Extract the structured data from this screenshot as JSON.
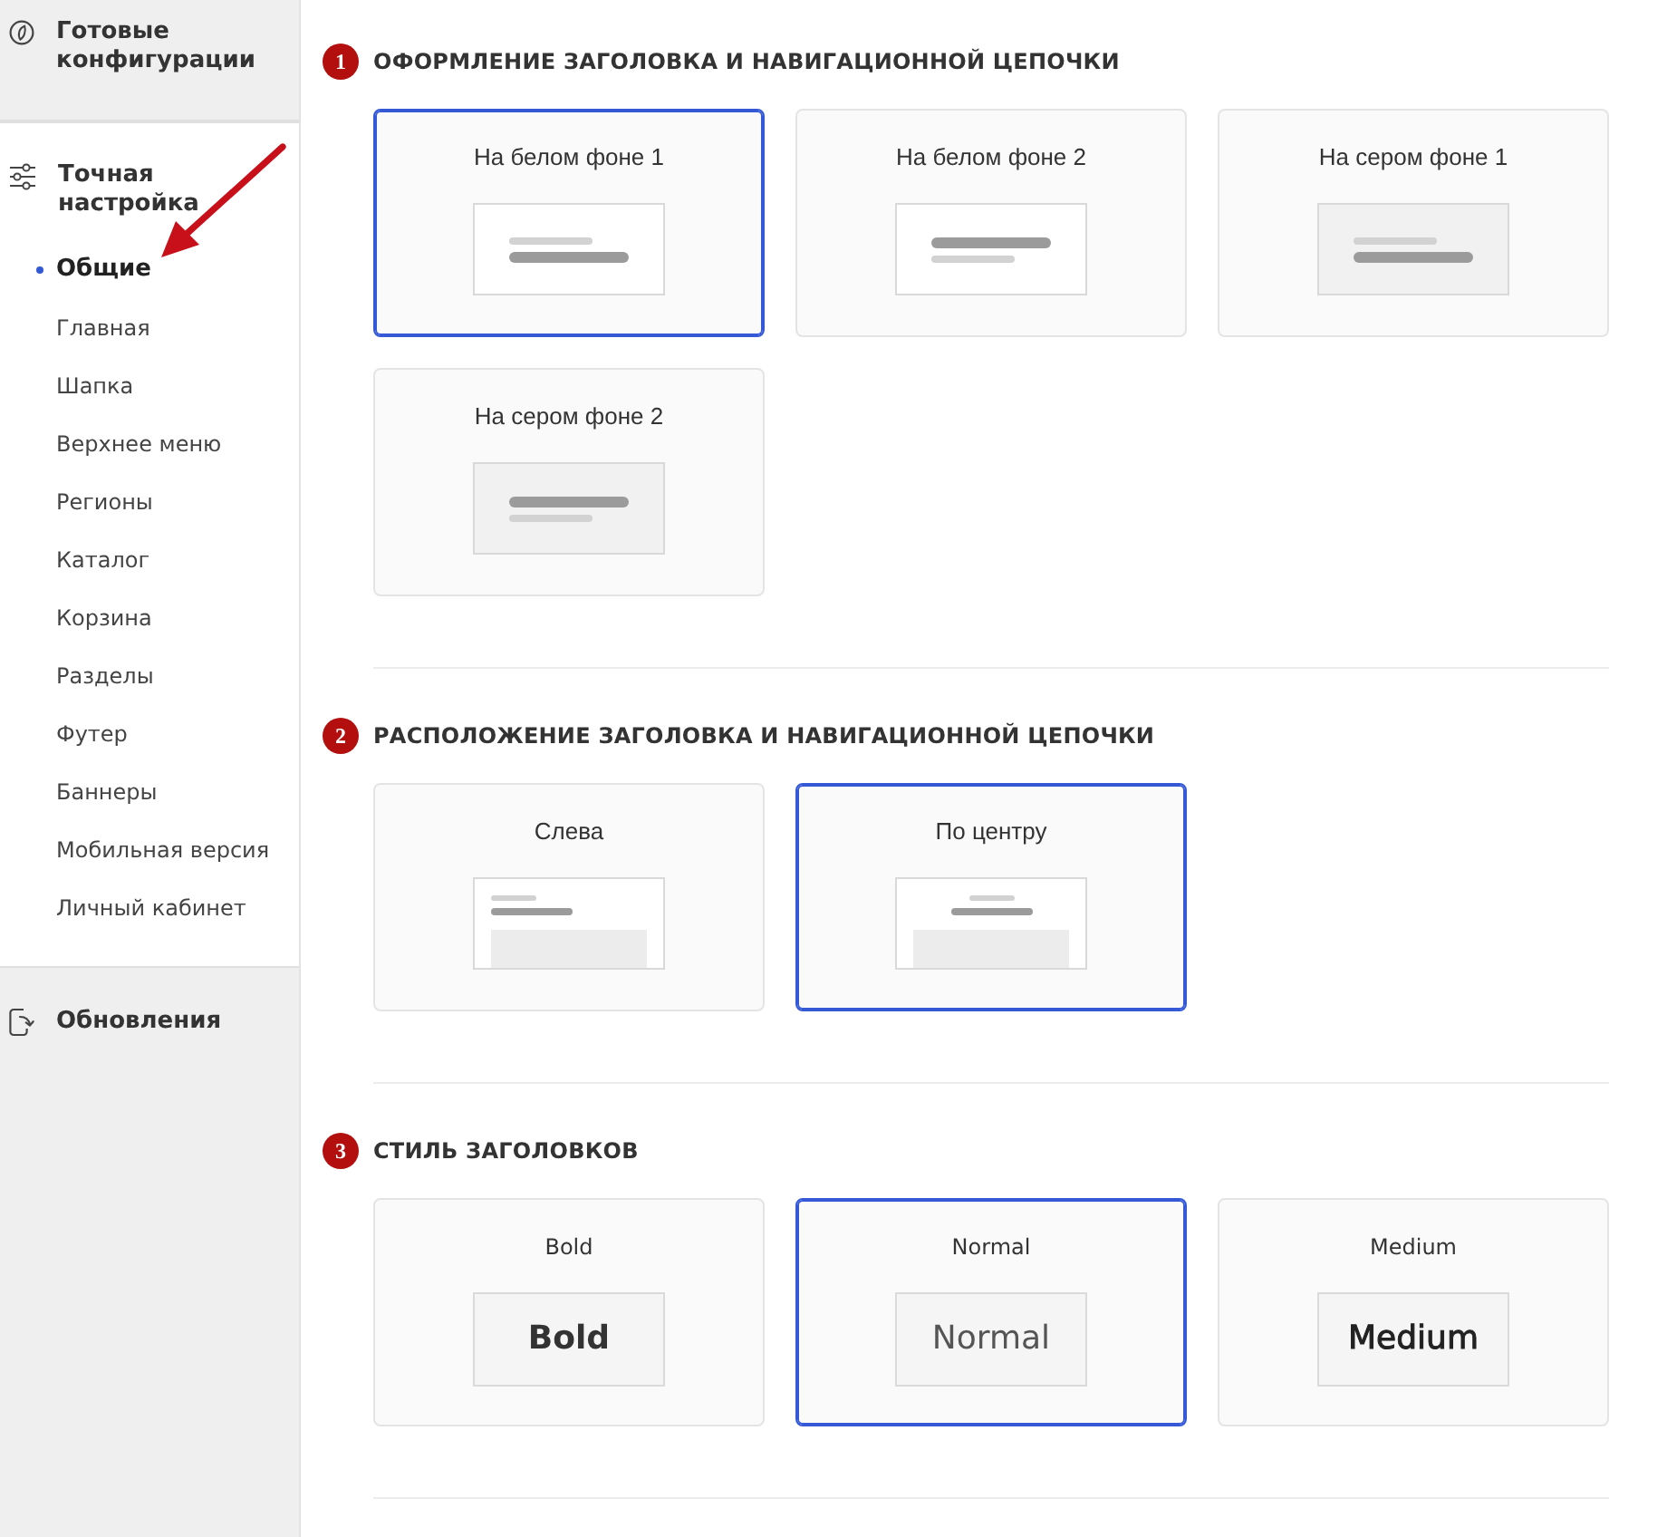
{
  "sidebar": {
    "sections": [
      {
        "kind": "presets",
        "label": "Готовые конфигурации",
        "expanded": false
      },
      {
        "kind": "tuning",
        "label": "Точная настройка",
        "expanded": true,
        "items": [
          {
            "label": "Общие",
            "selected": true
          },
          {
            "label": "Главная",
            "selected": false
          },
          {
            "label": "Шапка",
            "selected": false
          },
          {
            "label": "Верхнее меню",
            "selected": false
          },
          {
            "label": "Регионы",
            "selected": false
          },
          {
            "label": "Каталог",
            "selected": false
          },
          {
            "label": "Корзина",
            "selected": false
          },
          {
            "label": "Разделы",
            "selected": false
          },
          {
            "label": "Футер",
            "selected": false
          },
          {
            "label": "Баннеры",
            "selected": false
          },
          {
            "label": "Мобильная версия",
            "selected": false
          },
          {
            "label": "Личный кабинет",
            "selected": false
          }
        ]
      },
      {
        "kind": "updates",
        "label": "Обновления",
        "expanded": false
      }
    ]
  },
  "sections": [
    {
      "number": "1",
      "title": "ОФОРМЛЕНИЕ ЗАГОЛОВКА И НАВИГАЦИОННОЙ ЦЕПОЧКИ",
      "options": [
        {
          "label": "На белом фоне 1",
          "selected": true,
          "kind": "white",
          "dark_first": false
        },
        {
          "label": "На белом фоне 2",
          "selected": false,
          "kind": "white",
          "dark_first": true
        },
        {
          "label": "На сером фоне 1",
          "selected": false,
          "kind": "gray",
          "dark_first": false
        },
        {
          "label": "На сером фоне 2",
          "selected": false,
          "kind": "gray",
          "dark_first": true
        }
      ]
    },
    {
      "number": "2",
      "title": "РАСПОЛОЖЕНИЕ ЗАГОЛОВКА И НАВИГАЦИОННОЙ ЦЕПОЧКИ",
      "options": [
        {
          "label": "Слева",
          "selected": false,
          "kind": "layout",
          "centered": false
        },
        {
          "label": "По центру",
          "selected": true,
          "kind": "layout",
          "centered": true
        }
      ]
    },
    {
      "number": "3",
      "title": "СТИЛЬ ЗАГОЛОВКОВ",
      "options": [
        {
          "label": "Bold",
          "selected": false,
          "kind": "bold",
          "sample": "Bold"
        },
        {
          "label": "Normal",
          "selected": true,
          "kind": "normal",
          "sample": "Normal"
        },
        {
          "label": "Medium",
          "selected": false,
          "kind": "medium",
          "sample": "Medium"
        }
      ]
    }
  ]
}
